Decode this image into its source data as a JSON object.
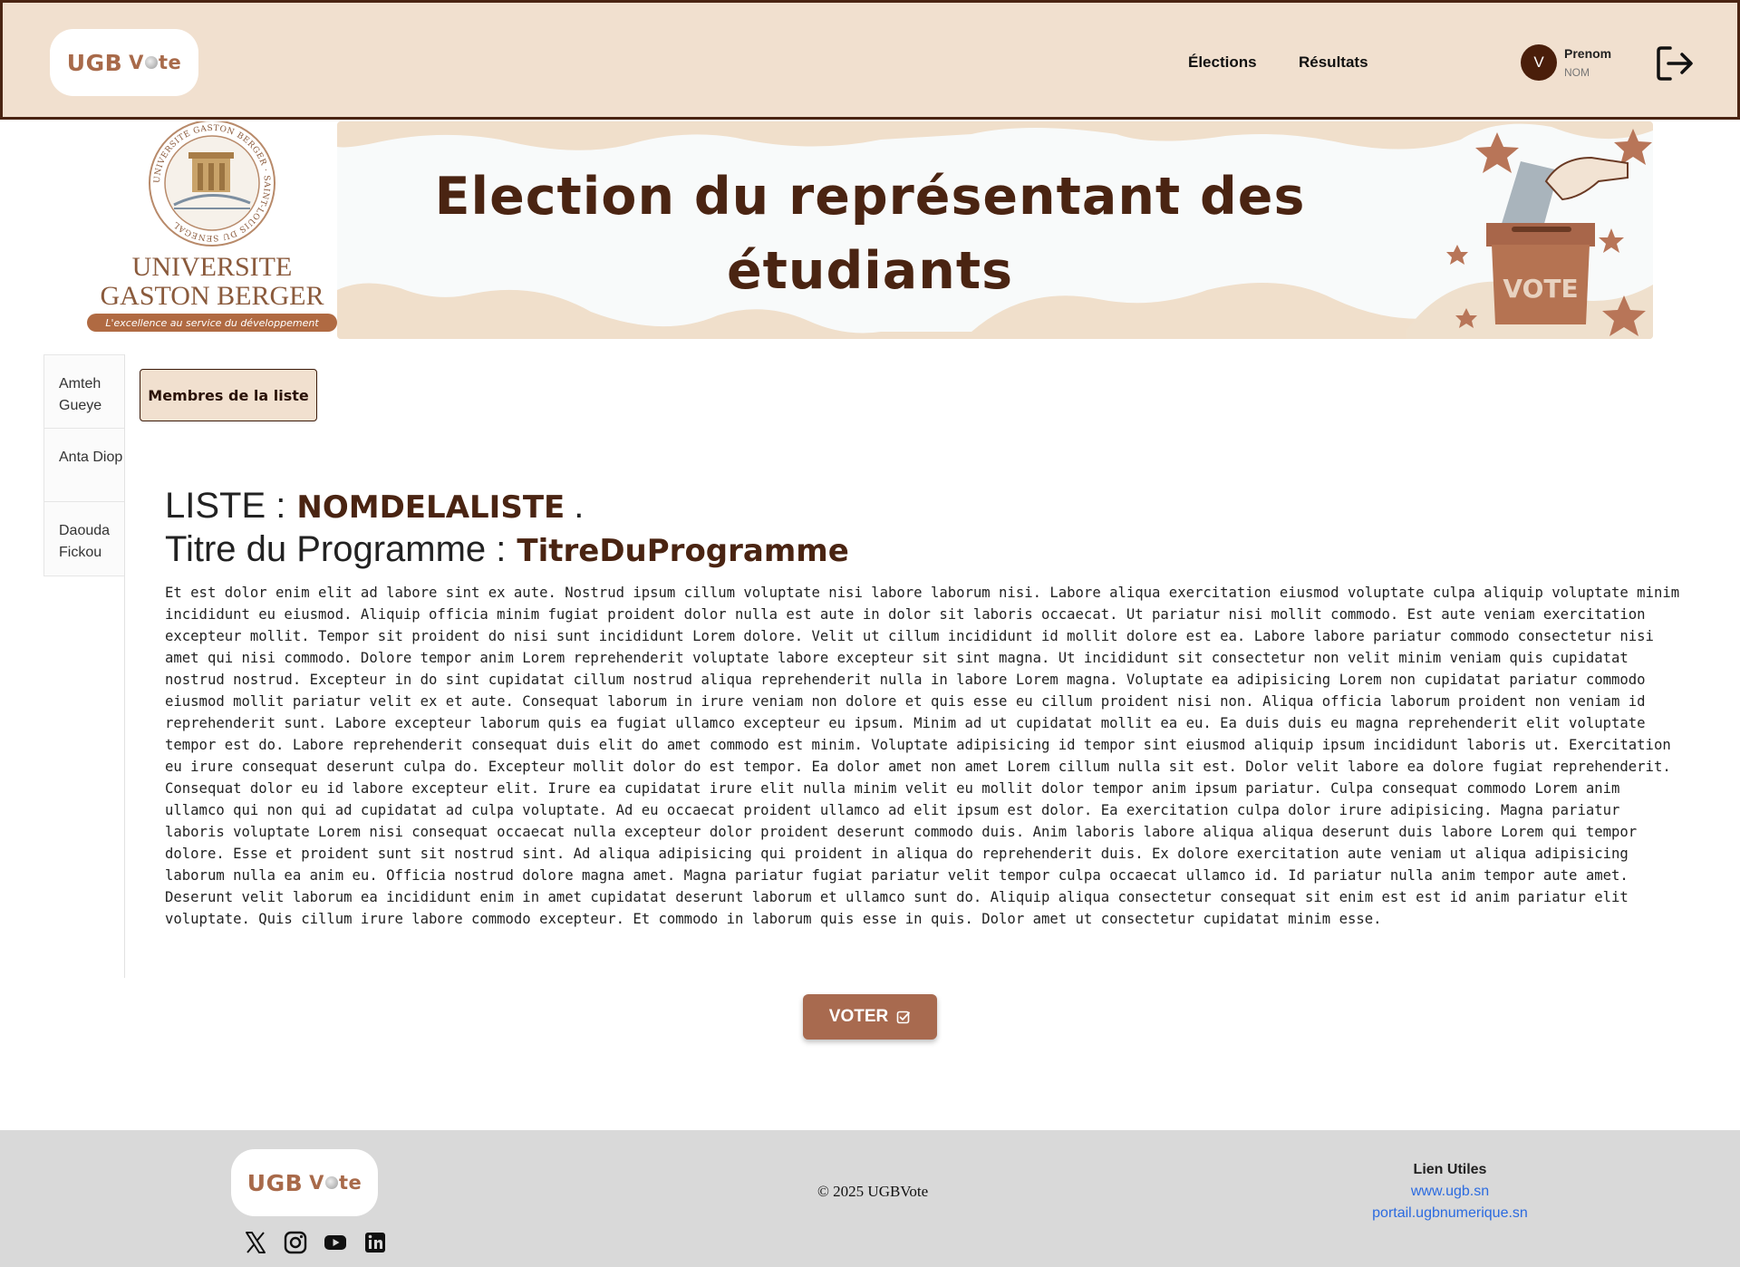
{
  "header": {
    "logo": {
      "ugb": "UGB",
      "vote_pre": "V",
      "vote_post": "te"
    },
    "nav": {
      "elections": "Élections",
      "resultats": "Résultats"
    },
    "user": {
      "initial": "V",
      "first_name": "Prenom",
      "last_name": "NOM"
    },
    "logout_icon": "logout-icon"
  },
  "banner": {
    "title": "Election du représentant des étudiants",
    "emblem": {
      "seal_text": "UNIVERSITE GASTON BERGER · SAINT-LOUIS DU SENEGAL",
      "name_line1": "UNIVERSITE",
      "name_line2": "GASTON BERGER",
      "tagline": "L'excellence au service du développement"
    },
    "ballot_box_label": "VOTE"
  },
  "sidebar": {
    "items": [
      {
        "label": "Amteh Gueye"
      },
      {
        "label": "Anta Diop"
      },
      {
        "label": "Daouda Fickou"
      }
    ]
  },
  "main": {
    "members_button": "Membres de la liste",
    "liste_label": "LISTE :",
    "liste_name": "NOMDELALISTE",
    "liste_suffix": ".",
    "programme_label": "Titre du Programme :",
    "programme_title": "TitreDuProgramme",
    "programme_text": "Et est dolor enim elit ad labore sint ex aute. Nostrud ipsum cillum voluptate nisi labore laborum nisi. Labore aliqua exercitation eiusmod voluptate culpa aliquip voluptate minim incididunt eu eiusmod. Aliquip officia minim fugiat proident dolor nulla est aute in dolor sit laboris occaecat. Ut pariatur nisi mollit commodo. Est aute veniam exercitation excepteur mollit. Tempor sit proident do nisi sunt incididunt Lorem dolore. Velit ut cillum incididunt id mollit dolore est ea. Labore labore pariatur commodo consectetur nisi amet qui nisi commodo. Dolore tempor anim Lorem reprehenderit voluptate labore excepteur sit sint magna. Ut incididunt sit consectetur non velit minim veniam quis cupidatat nostrud nostrud. Excepteur in do sint cupidatat cillum nostrud aliqua reprehenderit nulla in labore Lorem magna. Voluptate ea adipisicing Lorem non cupidatat pariatur commodo eiusmod mollit pariatur velit ex et aute. Consequat laborum in irure veniam non dolore et quis esse eu cillum proident nisi non. Aliqua officia laborum proident non veniam id reprehenderit sunt. Labore excepteur laborum quis ea fugiat ullamco excepteur eu ipsum. Minim ad ut cupidatat mollit ea eu. Ea duis duis eu magna reprehenderit elit voluptate tempor est do. Labore reprehenderit consequat duis elit do amet commodo est minim. Voluptate adipisicing id tempor sint eiusmod aliquip ipsum incididunt laboris ut. Exercitation eu irure consequat deserunt culpa do. Excepteur mollit dolor do est tempor. Ea dolor amet non amet Lorem cillum nulla sit est. Dolor velit labore ea dolore fugiat reprehenderit. Consequat dolor eu id labore excepteur elit. Irure ea cupidatat irure elit nulla minim velit eu mollit dolor tempor anim ipsum pariatur. Culpa consequat commodo Lorem anim ullamco qui non qui ad cupidatat ad culpa voluptate. Ad eu occaecat proident ullamco ad elit ipsum est dolor. Ea exercitation culpa dolor irure adipisicing. Magna pariatur laboris voluptate Lorem nisi consequat occaecat nulla excepteur dolor proident deserunt commodo duis. Anim laboris labore aliqua aliqua deserunt duis labore Lorem qui tempor dolore. Esse et proident sunt sit nostrud sint. Ad aliqua adipisicing qui proident in aliqua do reprehenderit duis. Ex dolore exercitation aute veniam ut aliqua adipisicing laborum nulla ea anim eu. Officia nostrud dolore magna amet. Magna pariatur fugiat pariatur velit tempor culpa occaecat ullamco id. Id pariatur nulla anim tempor aute amet. Deserunt velit laborum ea incididunt enim in amet cupidatat deserunt laborum et ullamco sunt do. Aliquip aliqua consectetur consequat sit enim est est id anim pariatur elit voluptate. Quis cillum irure labore commodo excepteur. Et commodo in laborum quis esse in quis. Dolor amet ut consectetur cupidatat minim esse.",
    "vote_button": "VOTER",
    "vote_icon": "check-square-icon"
  },
  "footer": {
    "logo": {
      "ugb": "UGB",
      "vote_pre": "V",
      "vote_post": "te"
    },
    "socials": [
      "x-icon",
      "instagram-icon",
      "youtube-icon",
      "linkedin-icon"
    ],
    "copyright": "© 2025 UGBVote",
    "links_title": "Lien Utiles",
    "links": [
      "www.ugb.sn",
      "portail.ugbnumerique.sn"
    ]
  },
  "colors": {
    "header_bg": "#f1e0cf",
    "brown_dark": "#4a2412",
    "accent_brown": "#a86a4f",
    "footer_bg": "#d9d9d9",
    "link_blue": "#2b6be0"
  }
}
